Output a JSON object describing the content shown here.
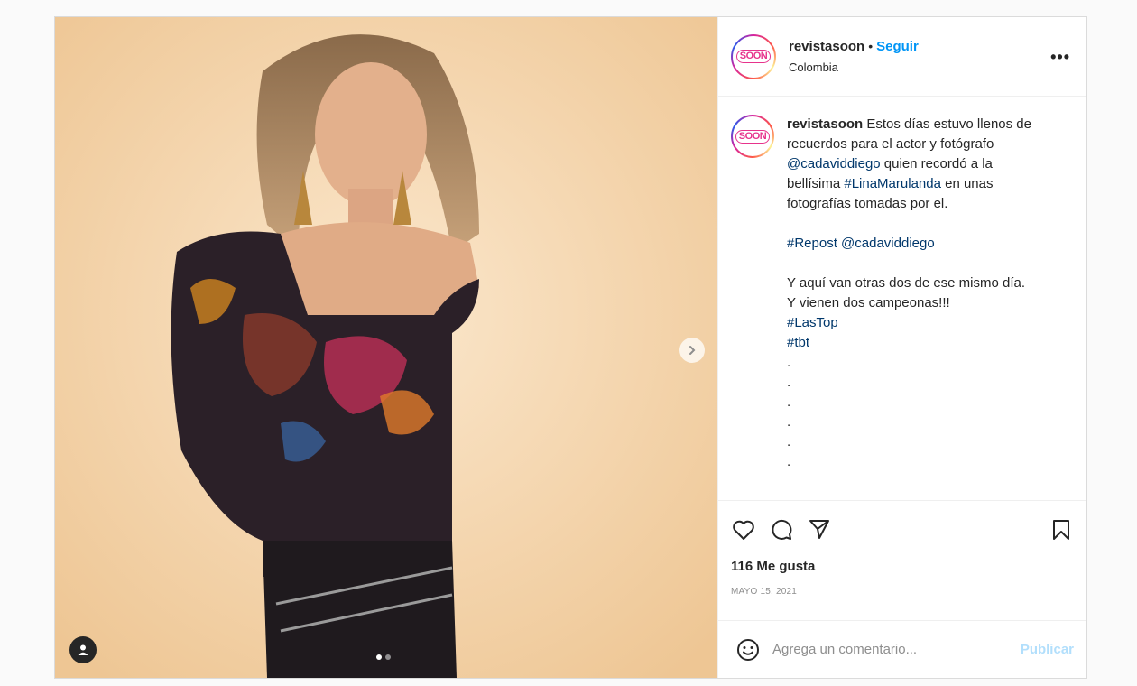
{
  "post": {
    "user": {
      "username": "revistasoon",
      "follow_label": "Seguir",
      "separator": "•",
      "location": "Colombia",
      "avatar_text": "SOON"
    },
    "more_label": "•••",
    "caption": {
      "username": "revistasoon",
      "intro_1": " Estos días estuvo llenos de recuerdos para el actor y fotógrafo ",
      "mention_1": "@cadaviddiego",
      "intro_2": " quien recordó a la bellísima ",
      "hashtag_1": "#LinaMarulanda",
      "intro_3": " en unas fotografías tomadas por el.",
      "repost_tag": "#Repost",
      "repost_mention": "@cadaviddiego",
      "line_1": "Y aquí van otras dos de ese mismo día.",
      "line_2": "Y vienen dos campeonas!!!",
      "hashtag_2": "#LasTop",
      "hashtag_3": "#tbt",
      "dots": [
        ".",
        ".",
        ".",
        ".",
        ".",
        "."
      ]
    },
    "likes": "116 Me gusta",
    "date": "MAYO 15, 2021",
    "comment": {
      "placeholder": "Agrega un comentario...",
      "publish_label": "Publicar"
    },
    "carousel": {
      "current": 1,
      "total": 2
    },
    "colors": {
      "link": "#00376b",
      "follow": "#0095f6",
      "publish_disabled": "#b2dffc"
    }
  }
}
